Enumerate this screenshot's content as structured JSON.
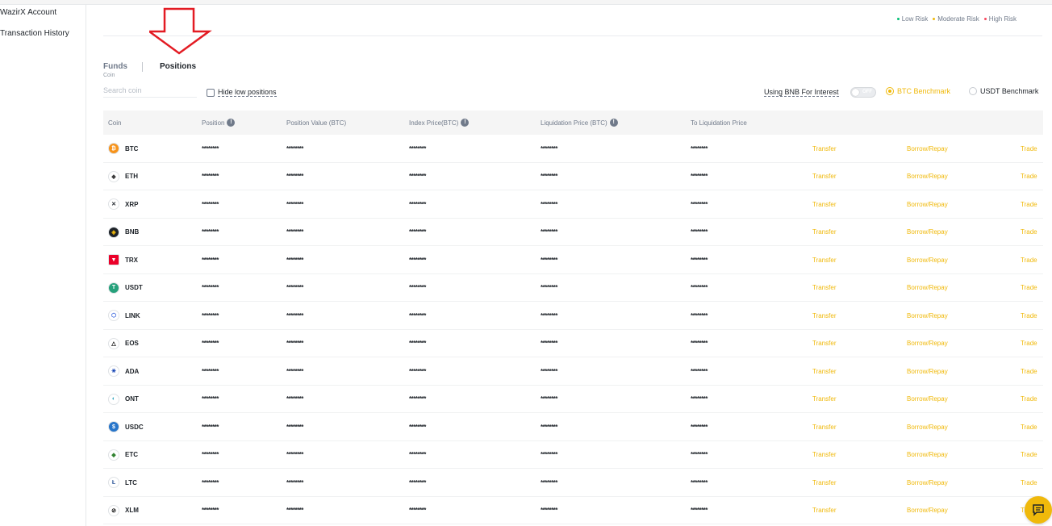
{
  "sidebar": {
    "items": [
      {
        "label": "WazirX Account"
      },
      {
        "label": "Transaction History"
      }
    ]
  },
  "risk_legend": {
    "low": "Low Risk",
    "moderate": "Moderate Risk",
    "high": "High Risk",
    "colors": {
      "low": "#02c076",
      "moderate": "#f0b90b",
      "high": "#f84960"
    }
  },
  "tabs": {
    "funds": "Funds",
    "positions": "Positions",
    "coin_sub": "Coin"
  },
  "search": {
    "placeholder": "Search coin",
    "value": ""
  },
  "hide_low": {
    "label": "Hide low positions",
    "checked": false
  },
  "bnb_interest": {
    "label": "Using BNB For Interest",
    "toggle_text": "OFF"
  },
  "benchmarks": {
    "btc": "BTC Benchmark",
    "usdt": "USDT Benchmark",
    "selected": "btc"
  },
  "table": {
    "headers": {
      "coin": "Coin",
      "position": "Position",
      "position_value": "Position Value (BTC)",
      "index_price": "Index Price(BTC)",
      "liquidation_price": "Liquidation Price (BTC)",
      "to_liquidation": "To Liquidation Price"
    },
    "actions": {
      "transfer": "Transfer",
      "borrow": "Borrow/Repay",
      "trade": "Trade"
    },
    "masked": "********",
    "rows": [
      {
        "coin": "BTC",
        "icon": "btc-icon",
        "color": "#f7931a"
      },
      {
        "coin": "ETH",
        "icon": "eth-icon",
        "color": "#ffffff"
      },
      {
        "coin": "XRP",
        "icon": "xrp-icon",
        "color": "#ffffff"
      },
      {
        "coin": "BNB",
        "icon": "bnb-icon",
        "color": "#1e2329"
      },
      {
        "coin": "TRX",
        "icon": "trx-icon",
        "color": "#eb0029"
      },
      {
        "coin": "USDT",
        "icon": "usdt-icon",
        "color": "#26a17b"
      },
      {
        "coin": "LINK",
        "icon": "link-icon",
        "color": "#ffffff"
      },
      {
        "coin": "EOS",
        "icon": "eos-icon",
        "color": "#ffffff"
      },
      {
        "coin": "ADA",
        "icon": "ada-icon",
        "color": "#ffffff"
      },
      {
        "coin": "ONT",
        "icon": "ont-icon",
        "color": "#ffffff"
      },
      {
        "coin": "USDC",
        "icon": "usdc-icon",
        "color": "#2775ca"
      },
      {
        "coin": "ETC",
        "icon": "etc-icon",
        "color": "#ffffff"
      },
      {
        "coin": "LTC",
        "icon": "ltc-icon",
        "color": "#ffffff"
      },
      {
        "coin": "XLM",
        "icon": "xlm-icon",
        "color": "#ffffff"
      }
    ]
  },
  "accent_color": "#f0b90b"
}
